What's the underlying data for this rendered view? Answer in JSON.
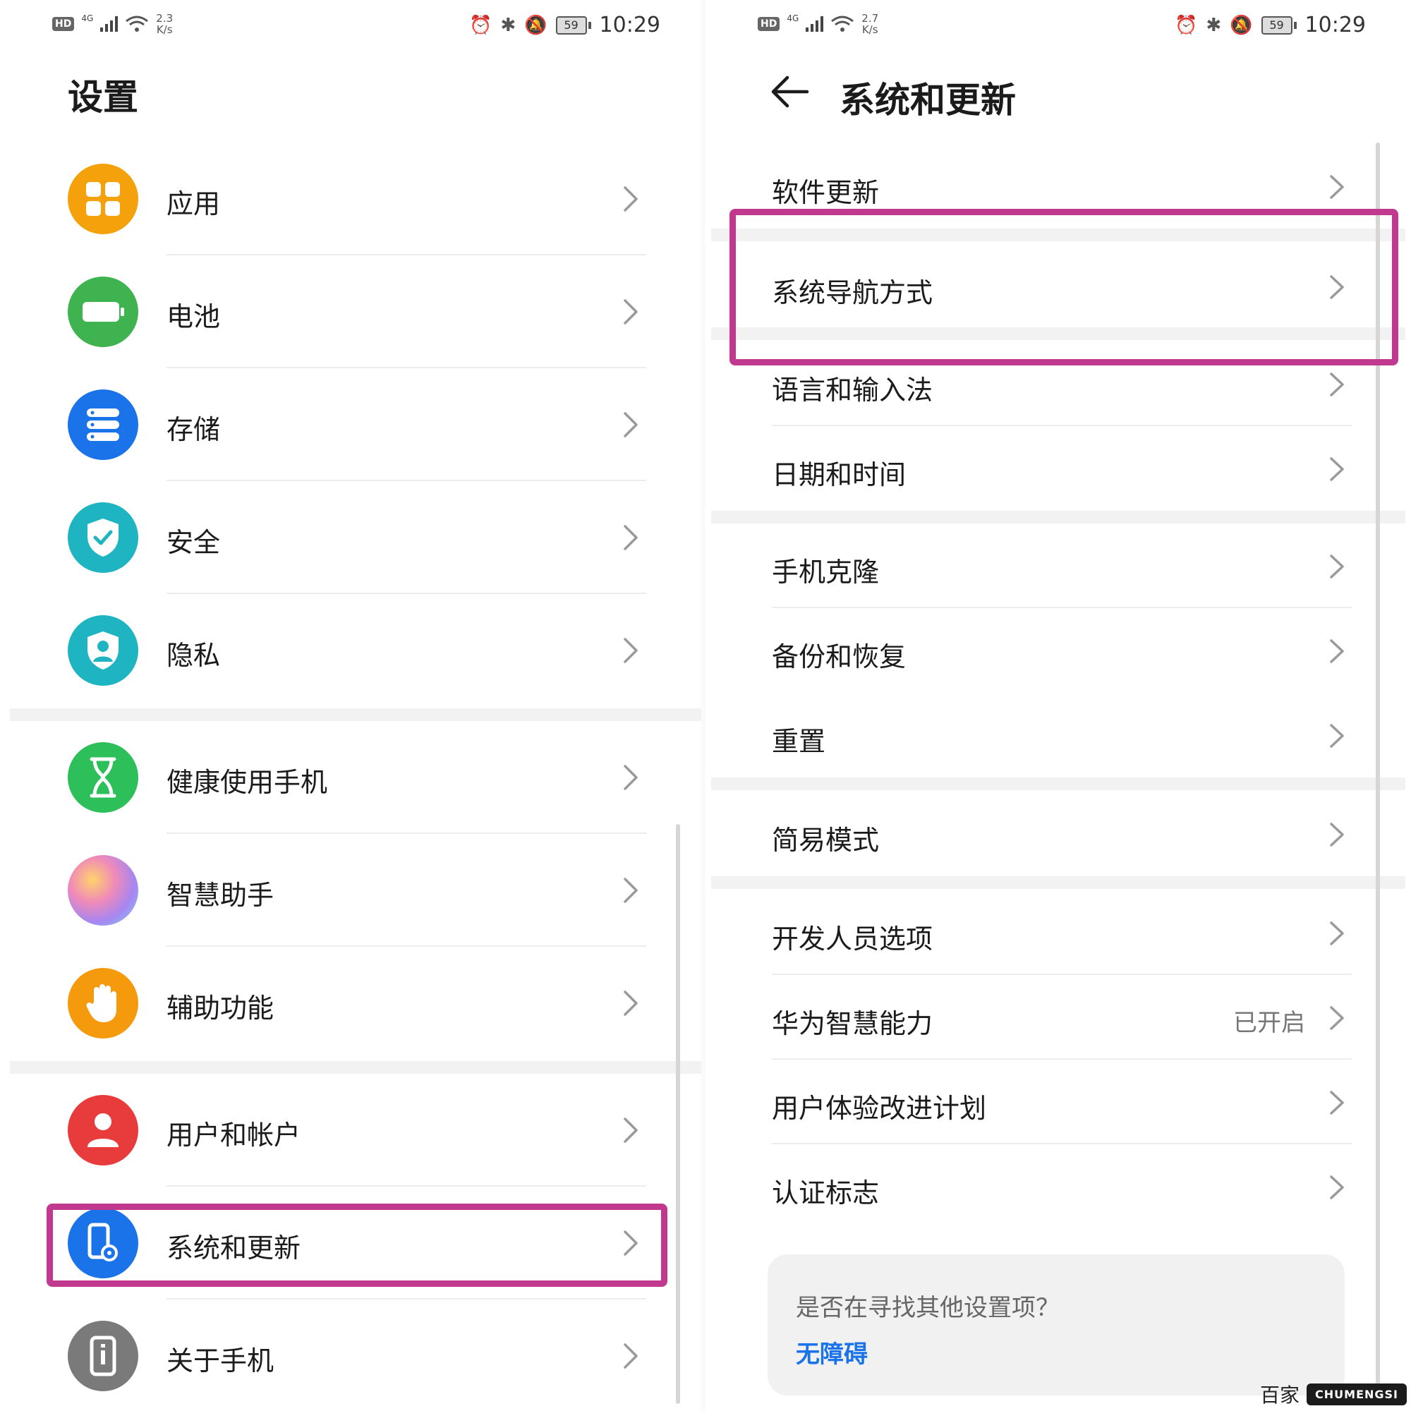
{
  "status_left": {
    "hd": "HD",
    "net": "4G",
    "speed_value": "2.3",
    "speed_unit": "K/s",
    "battery": "59",
    "time": "10:29"
  },
  "status_right": {
    "hd": "HD",
    "net": "4G",
    "speed_value": "2.7",
    "speed_unit": "K/s",
    "battery": "59",
    "time": "10:29"
  },
  "settings": {
    "title": "设置",
    "items": [
      {
        "label": "应用",
        "icon": "apps-icon",
        "color": "#f5a10c"
      },
      {
        "label": "电池",
        "icon": "battery-icon",
        "color": "#3fb34f"
      },
      {
        "label": "存储",
        "icon": "storage-icon",
        "color": "#1a73e8"
      },
      {
        "label": "安全",
        "icon": "shield-check-icon",
        "color": "#1fb4c1"
      },
      {
        "label": "隐私",
        "icon": "privacy-icon",
        "color": "#1fb4c1"
      },
      {
        "label": "健康使用手机",
        "icon": "hourglass-icon",
        "color": "#2cbf5a"
      },
      {
        "label": "智慧助手",
        "icon": "assistant-orb-icon",
        "color": "#c48ee8"
      },
      {
        "label": "辅助功能",
        "icon": "hand-icon",
        "color": "#f59a0c"
      },
      {
        "label": "用户和帐户",
        "icon": "user-icon",
        "color": "#e83b3b"
      },
      {
        "label": "系统和更新",
        "icon": "system-update-icon",
        "color": "#1a73e8"
      },
      {
        "label": "关于手机",
        "icon": "phone-info-icon",
        "color": "#7a7a7a"
      }
    ]
  },
  "system": {
    "title": "系统和更新",
    "items": [
      {
        "label": "软件更新"
      },
      {
        "label": "系统导航方式"
      },
      {
        "label": "语言和输入法"
      },
      {
        "label": "日期和时间"
      },
      {
        "label": "手机克隆"
      },
      {
        "label": "备份和恢复"
      },
      {
        "label": "重置"
      },
      {
        "label": "简易模式"
      },
      {
        "label": "开发人员选项"
      },
      {
        "label": "华为智慧能力",
        "value": "已开启"
      },
      {
        "label": "用户体验改进计划"
      },
      {
        "label": "认证标志"
      }
    ],
    "card": {
      "question": "是否在寻找其他设置项？",
      "link": "无障碍"
    }
  },
  "highlight_color": "#c0398f",
  "watermark": {
    "text": "百家",
    "logo": "CHUMENGSI"
  }
}
